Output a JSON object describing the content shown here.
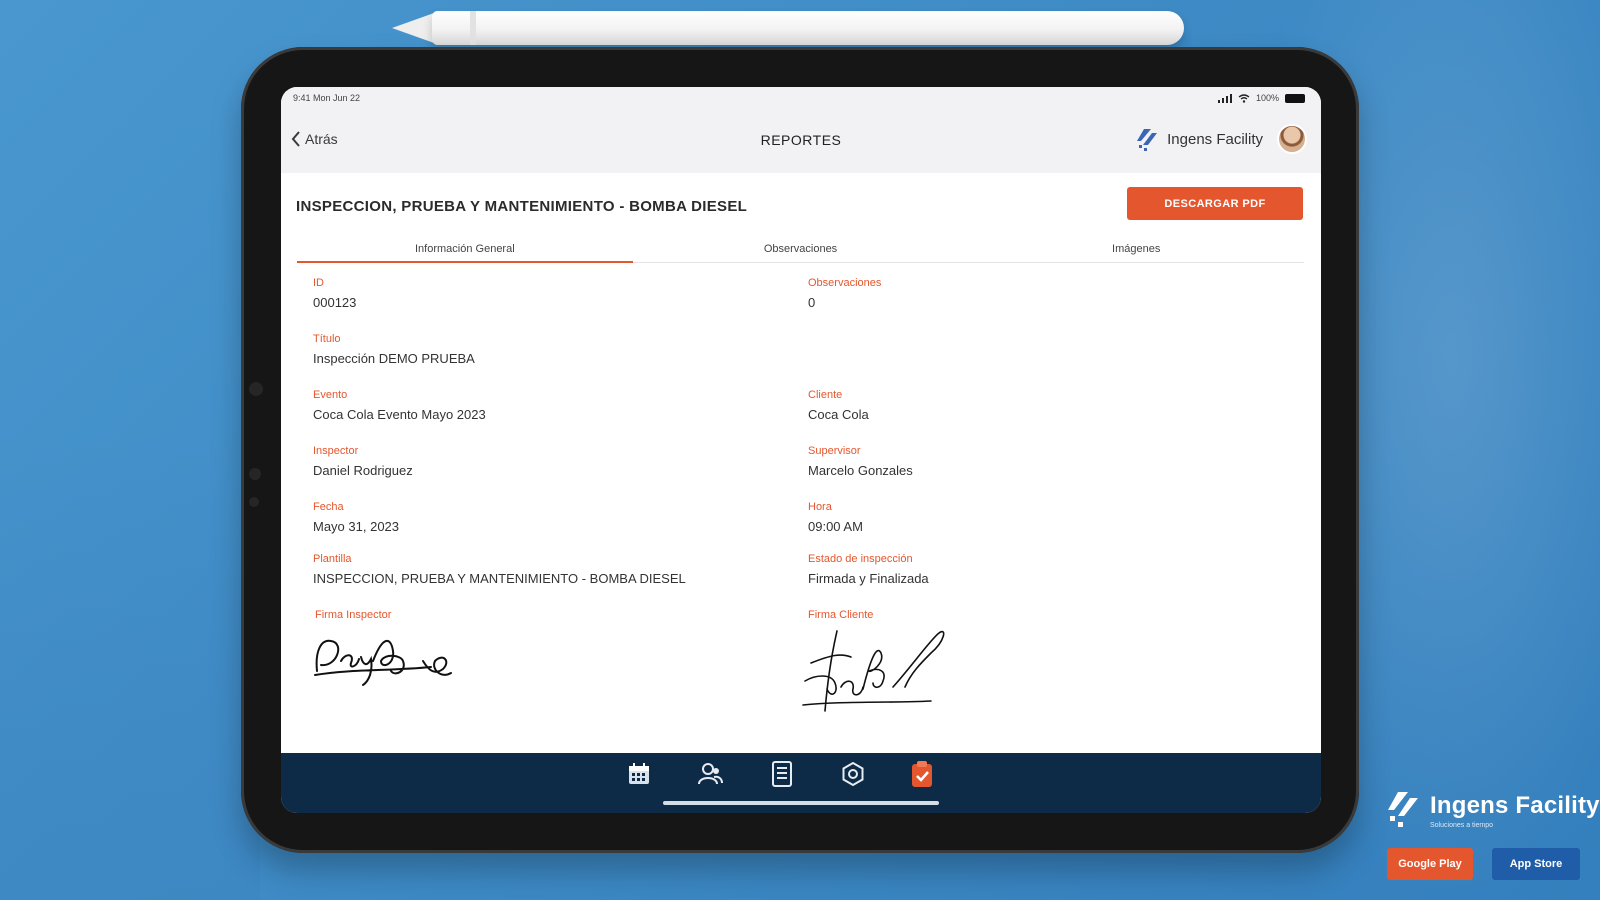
{
  "status_bar": {
    "time_date": "9:41  Mon Jun 22",
    "battery": "100%"
  },
  "nav": {
    "back_label": "Atrás",
    "title": "REPORTES",
    "brand": "Ingens Facility"
  },
  "report": {
    "title": "INSPECCION, PRUEBA Y MANTENIMIENTO - BOMBA DIESEL",
    "download_label": "DESCARGAR PDF"
  },
  "tabs": [
    {
      "label": "Información General"
    },
    {
      "label": "Observaciones"
    },
    {
      "label": "Imágenes"
    }
  ],
  "fields": {
    "id": {
      "label": "ID",
      "value": "000123"
    },
    "observaciones": {
      "label": "Observaciones",
      "value": "0"
    },
    "titulo": {
      "label": "Título",
      "value": "Inspección DEMO PRUEBA"
    },
    "evento": {
      "label": "Evento",
      "value": "Coca Cola Evento Mayo 2023"
    },
    "cliente": {
      "label": "Cliente",
      "value": "Coca Cola"
    },
    "inspector": {
      "label": "Inspector",
      "value": "Daniel Rodriguez"
    },
    "supervisor": {
      "label": "Supervisor",
      "value": "Marcelo Gonzales"
    },
    "fecha": {
      "label": "Fecha",
      "value": "Mayo 31, 2023"
    },
    "hora": {
      "label": "Hora",
      "value": "09:00 AM"
    },
    "plantilla": {
      "label": "Plantilla",
      "value": "INSPECCION, PRUEBA Y MANTENIMIENTO - BOMBA DIESEL"
    },
    "estado": {
      "label": "Estado de inspección",
      "value": "Firmada y Finalizada"
    },
    "firma_inspector": {
      "label": "Firma Inspector"
    },
    "firma_cliente": {
      "label": "Firma Cliente"
    }
  },
  "bottom_tabs": [
    {
      "icon": "calendar-icon"
    },
    {
      "icon": "users-icon"
    },
    {
      "icon": "document-icon"
    },
    {
      "icon": "settings-icon"
    },
    {
      "icon": "clipboard-check-icon",
      "active": true
    }
  ],
  "promo": {
    "brand": "Ingens Facility",
    "tagline": "Soluciones a tiempo",
    "google_play": "Google Play",
    "app_store": "App Store"
  },
  "colors": {
    "accent": "#e4572e",
    "tabbar": "#0d2a47",
    "background": "#3e8bc6",
    "appstore": "#1f5da8"
  }
}
